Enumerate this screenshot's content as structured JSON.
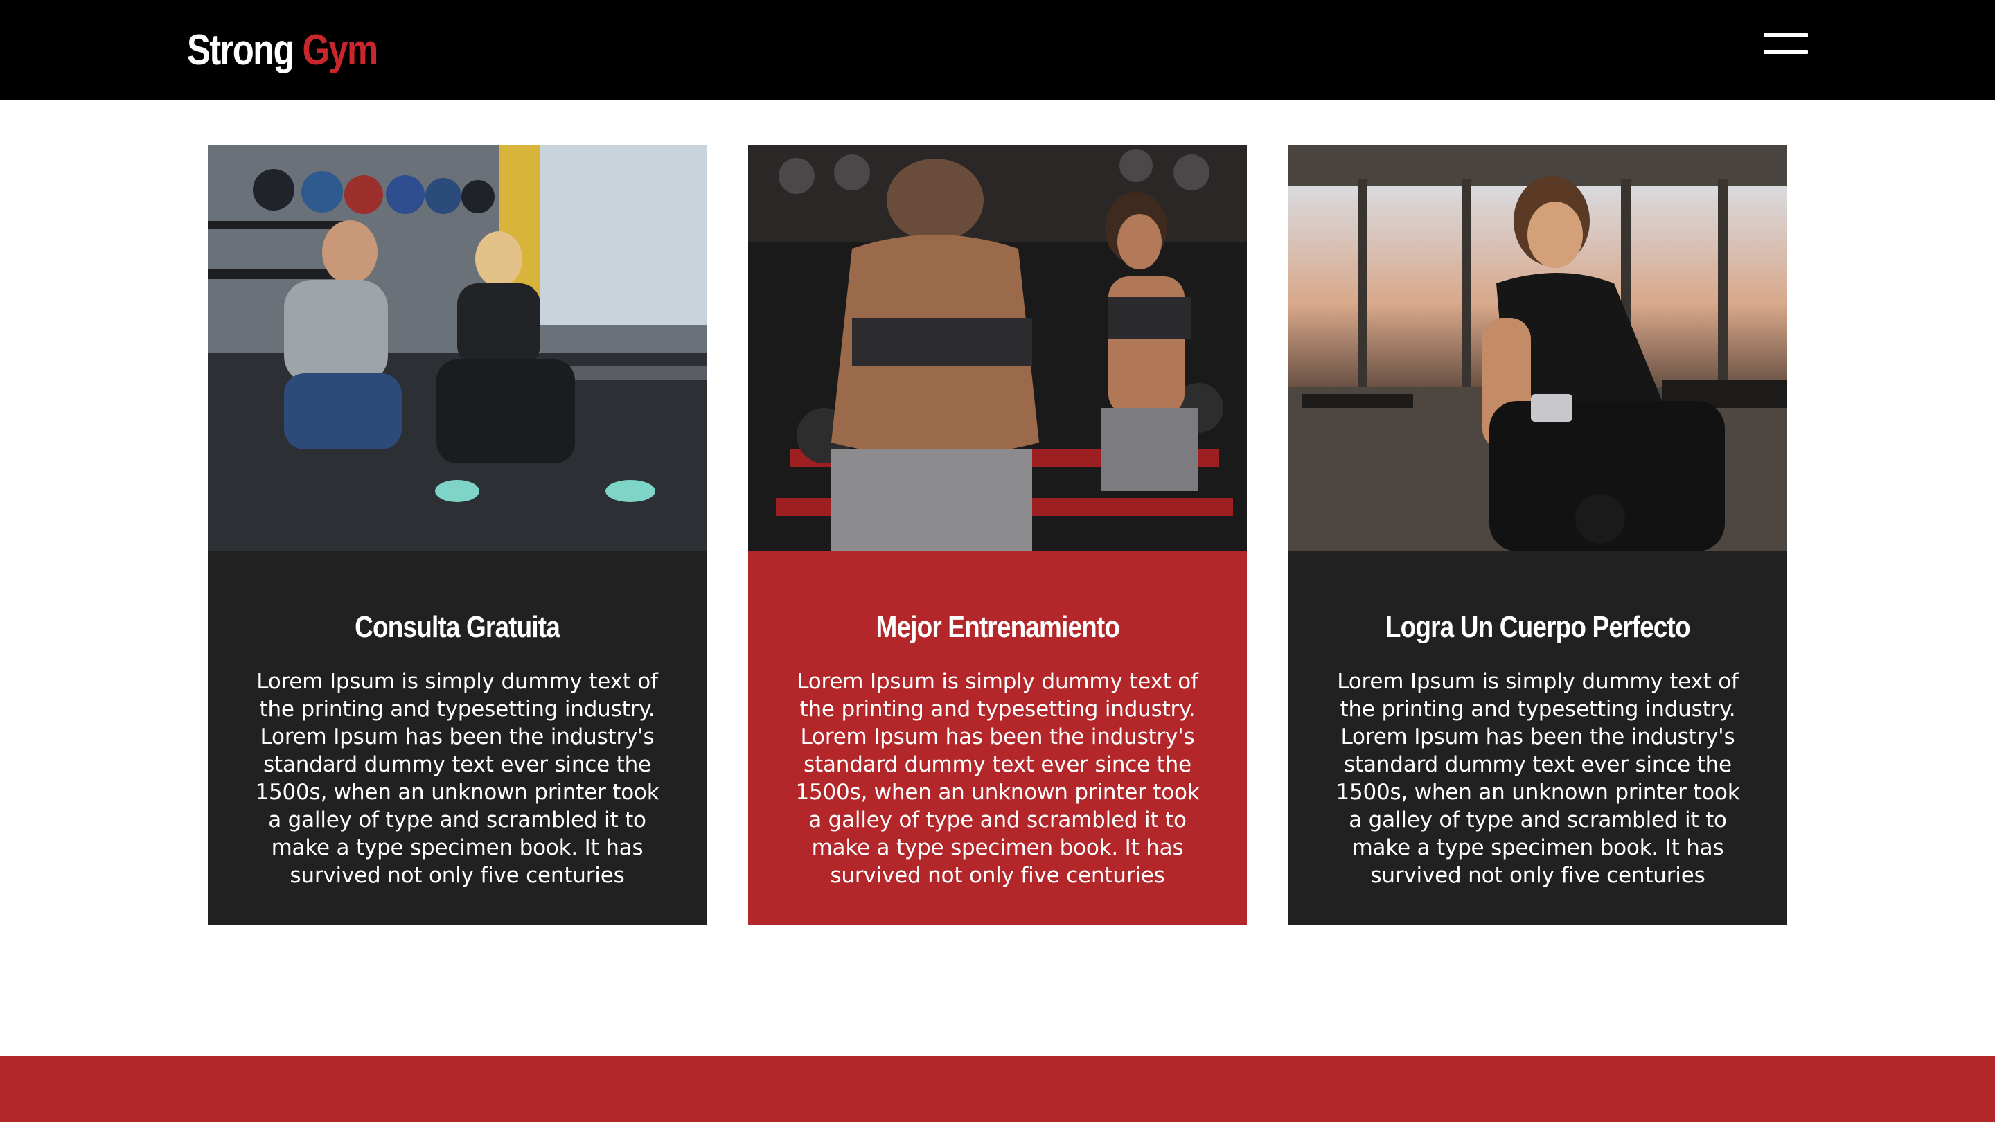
{
  "header": {
    "logo_part1": "Strong",
    "logo_part2": "Gym",
    "menu_icon": "hamburger-menu-icon"
  },
  "cards": [
    {
      "title": "Consulta Gratuita",
      "text": "Lorem Ipsum is simply dummy text of the printing and typesetting industry. Lorem Ipsum has been the industry's standard dummy text ever since the 1500s, when an unknown printer took a galley of type and scrambled it to make a type specimen book. It has survived not only five centuries",
      "style": "dark"
    },
    {
      "title": "Mejor Entrenamiento",
      "text": "Lorem Ipsum is simply dummy text of the printing and typesetting industry. Lorem Ipsum has been the industry's standard dummy text ever since the 1500s, when an unknown printer took a galley of type and scrambled it to make a type specimen book. It has survived not only five centuries",
      "style": "red"
    },
    {
      "title": "Logra Un Cuerpo Perfecto",
      "text": "Lorem Ipsum is simply dummy text of the printing and typesetting industry. Lorem Ipsum has been the industry's standard dummy text ever since the 1500s, when an unknown printer took a galley of type and scrambled it to make a type specimen book. It has survived not only five centuries",
      "style": "dark"
    }
  ],
  "colors": {
    "header_bg": "#000000",
    "accent_red": "#b3272b",
    "logo_red": "#c9272c",
    "card_dark": "#212121",
    "page_bg": "#ffffff"
  }
}
